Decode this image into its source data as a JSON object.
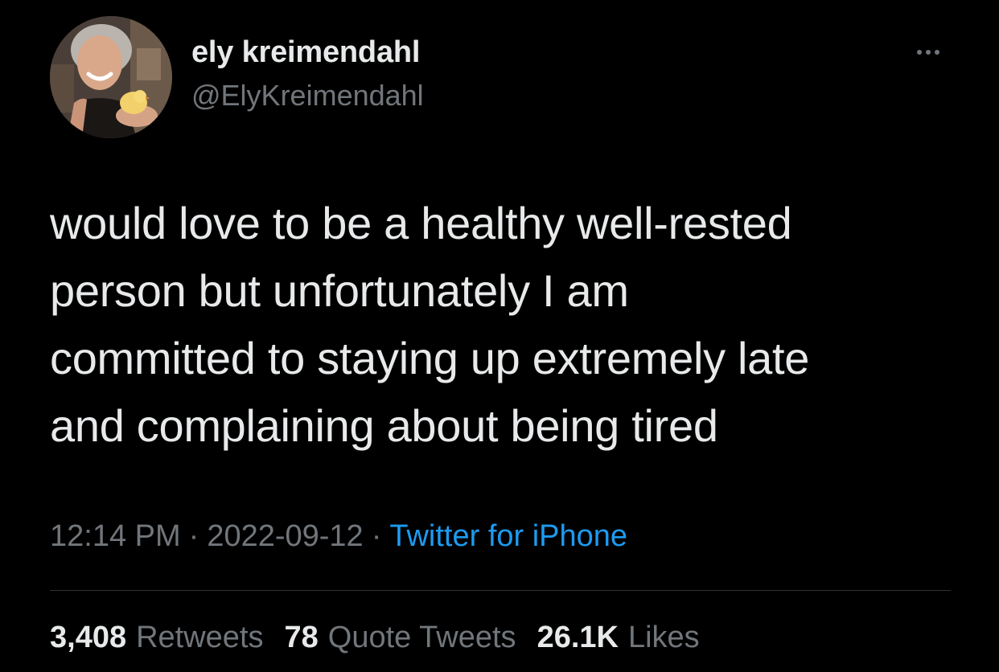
{
  "author": {
    "display_name": "ely kreimendahl",
    "handle": "@ElyKreimendahl",
    "avatar_icon": "profile-photo"
  },
  "menu": {
    "icon": "more-horizontal-icon"
  },
  "tweet": {
    "lines": [
      "would love to be a healthy well-rested",
      "person but unfortunately I am",
      "committed to staying up extremely late",
      "and complaining about being tired"
    ]
  },
  "meta": {
    "time": "12:14 PM",
    "separator": "·",
    "date": "2022-09-12",
    "source": "Twitter for iPhone"
  },
  "stats": {
    "retweets": {
      "count": "3,408",
      "label": "Retweets"
    },
    "quote_tweets": {
      "count": "78",
      "label": "Quote Tweets"
    },
    "likes": {
      "count": "26.1K",
      "label": "Likes"
    }
  },
  "colors": {
    "background": "#000000",
    "primary_text": "#e7e9ea",
    "secondary_text": "#71767b",
    "link": "#1d9bf0",
    "divider": "#2f3336"
  }
}
